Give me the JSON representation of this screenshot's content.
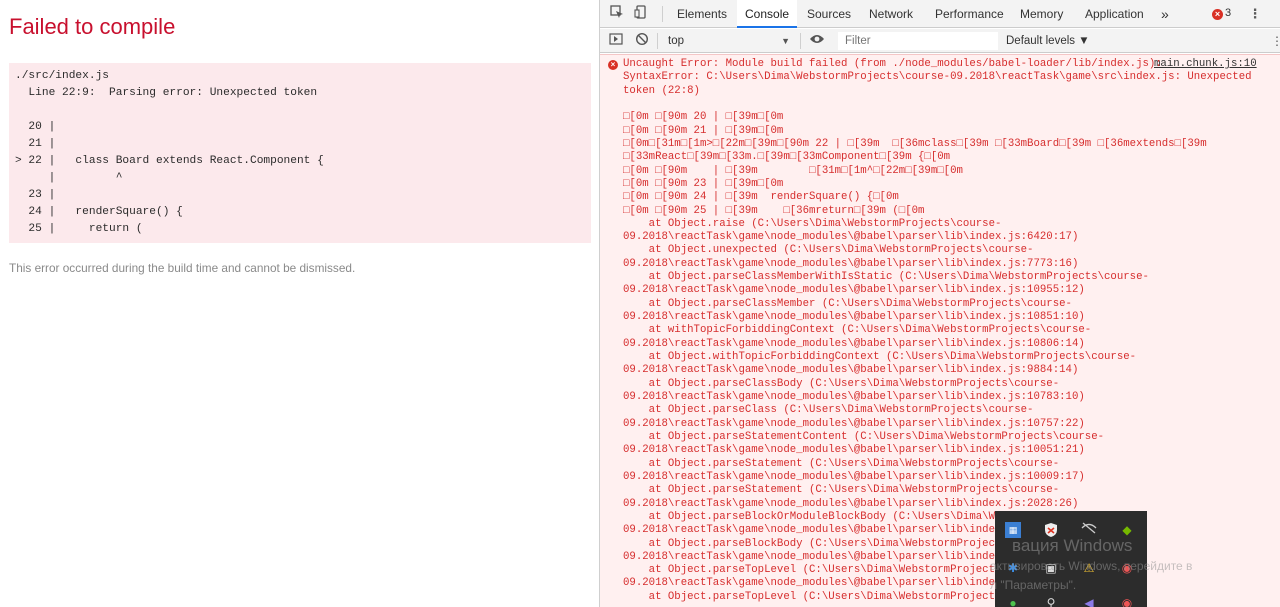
{
  "overlay": {
    "title": "Failed to compile",
    "file": "./src/index.js",
    "error_line": "  Line 22:9:  Parsing error: Unexpected token",
    "code_lines": [
      "  20 |",
      "  21 |",
      "> 22 |   class Board extends React.Component {",
      "     |         ^",
      "  23 |",
      "  24 |   renderSquare() {",
      "  25 |     return ("
    ],
    "note": "This error occurred during the build time and cannot be dismissed."
  },
  "devtools": {
    "tabs": [
      "Elements",
      "Console",
      "Sources",
      "Network",
      "Performance",
      "Memory",
      "Application"
    ],
    "active_tab": "Console",
    "more_tabs": "»",
    "error_count": "3",
    "context_select": "top",
    "filter_placeholder": "Filter",
    "levels": "Default levels ▼",
    "source_link": "main.chunk.js:10",
    "console_lines": [
      "Uncaught Error: Module build failed (from ./node_modules/babel-loader/lib/index.js):",
      "SyntaxError: C:\\Users\\Dima\\WebstormProjects\\course-09.2018\\reactTask\\game\\src\\index.js: Unexpected",
      "token (22:8)",
      "",
      "□[0m □[90m 20 | □[39m□[0m",
      "□[0m □[90m 21 | □[39m□[0m",
      "□[0m□[31m□[1m>□[22m□[39m□[90m 22 | □[39m  □[36mclass□[39m □[33mBoard□[39m □[36mextends□[39m",
      "□[33mReact□[39m□[33m.□[39m□[33mComponent□[39m {□[0m",
      "□[0m □[90m    | □[39m        □[31m□[1m^□[22m□[39m□[0m",
      "□[0m □[90m 23 | □[39m□[0m",
      "□[0m □[90m 24 | □[39m  renderSquare() {□[0m",
      "□[0m □[90m 25 | □[39m    □[36mreturn□[39m (□[0m",
      "    at Object.raise (C:\\Users\\Dima\\WebstormProjects\\course-",
      "09.2018\\reactTask\\game\\node_modules\\@babel\\parser\\lib\\index.js:6420:17)",
      "    at Object.unexpected (C:\\Users\\Dima\\WebstormProjects\\course-",
      "09.2018\\reactTask\\game\\node_modules\\@babel\\parser\\lib\\index.js:7773:16)",
      "    at Object.parseClassMemberWithIsStatic (C:\\Users\\Dima\\WebstormProjects\\course-",
      "09.2018\\reactTask\\game\\node_modules\\@babel\\parser\\lib\\index.js:10955:12)",
      "    at Object.parseClassMember (C:\\Users\\Dima\\WebstormProjects\\course-",
      "09.2018\\reactTask\\game\\node_modules\\@babel\\parser\\lib\\index.js:10851:10)",
      "    at withTopicForbiddingContext (C:\\Users\\Dima\\WebstormProjects\\course-",
      "09.2018\\reactTask\\game\\node_modules\\@babel\\parser\\lib\\index.js:10806:14)",
      "    at Object.withTopicForbiddingContext (C:\\Users\\Dima\\WebstormProjects\\course-",
      "09.2018\\reactTask\\game\\node_modules\\@babel\\parser\\lib\\index.js:9884:14)",
      "    at Object.parseClassBody (C:\\Users\\Dima\\WebstormProjects\\course-",
      "09.2018\\reactTask\\game\\node_modules\\@babel\\parser\\lib\\index.js:10783:10)",
      "    at Object.parseClass (C:\\Users\\Dima\\WebstormProjects\\course-",
      "09.2018\\reactTask\\game\\node_modules\\@babel\\parser\\lib\\index.js:10757:22)",
      "    at Object.parseStatementContent (C:\\Users\\Dima\\WebstormProjects\\course-",
      "09.2018\\reactTask\\game\\node_modules\\@babel\\parser\\lib\\index.js:10051:21)",
      "    at Object.parseStatement (C:\\Users\\Dima\\WebstormProjects\\course-",
      "09.2018\\reactTask\\game\\node_modules\\@babel\\parser\\lib\\index.js:10009:17)",
      "    at Object.parseStatement (C:\\Users\\Dima\\WebstormProjects\\course-",
      "09.2018\\reactTask\\game\\node_modules\\@babel\\parser\\lib\\index.js:2028:26)",
      "    at Object.parseBlockOrModuleBlockBody (C:\\Users\\Dima\\We",
      "09.2018\\reactTask\\game\\node_modules\\@babel\\parser\\lib\\index",
      "    at Object.parseBlockBody (C:\\Users\\Dima\\WebstormProject",
      "09.2018\\reactTask\\game\\node_modules\\@babel\\parser\\lib\\index",
      "    at Object.parseTopLevel (C:\\Users\\Dima\\WebstormProjects",
      "09.2018\\reactTask\\game\\node_modules\\@babel\\parser\\lib\\index",
      "    at Object.parseTopLevel (C:\\Users\\Dima\\WebstormProjects"
    ]
  },
  "watermark": {
    "line1": "вация Windows",
    "line2": "активировать Windows, перейдите в",
    "line3": "л \"Параметры\"."
  },
  "colors": {
    "error_red": "#d62d2d",
    "title_red": "#c8102e",
    "console_error_bg": "#fff0f0",
    "code_box_bg": "#fce9ec",
    "active_tab_underline": "#1a73e8"
  }
}
